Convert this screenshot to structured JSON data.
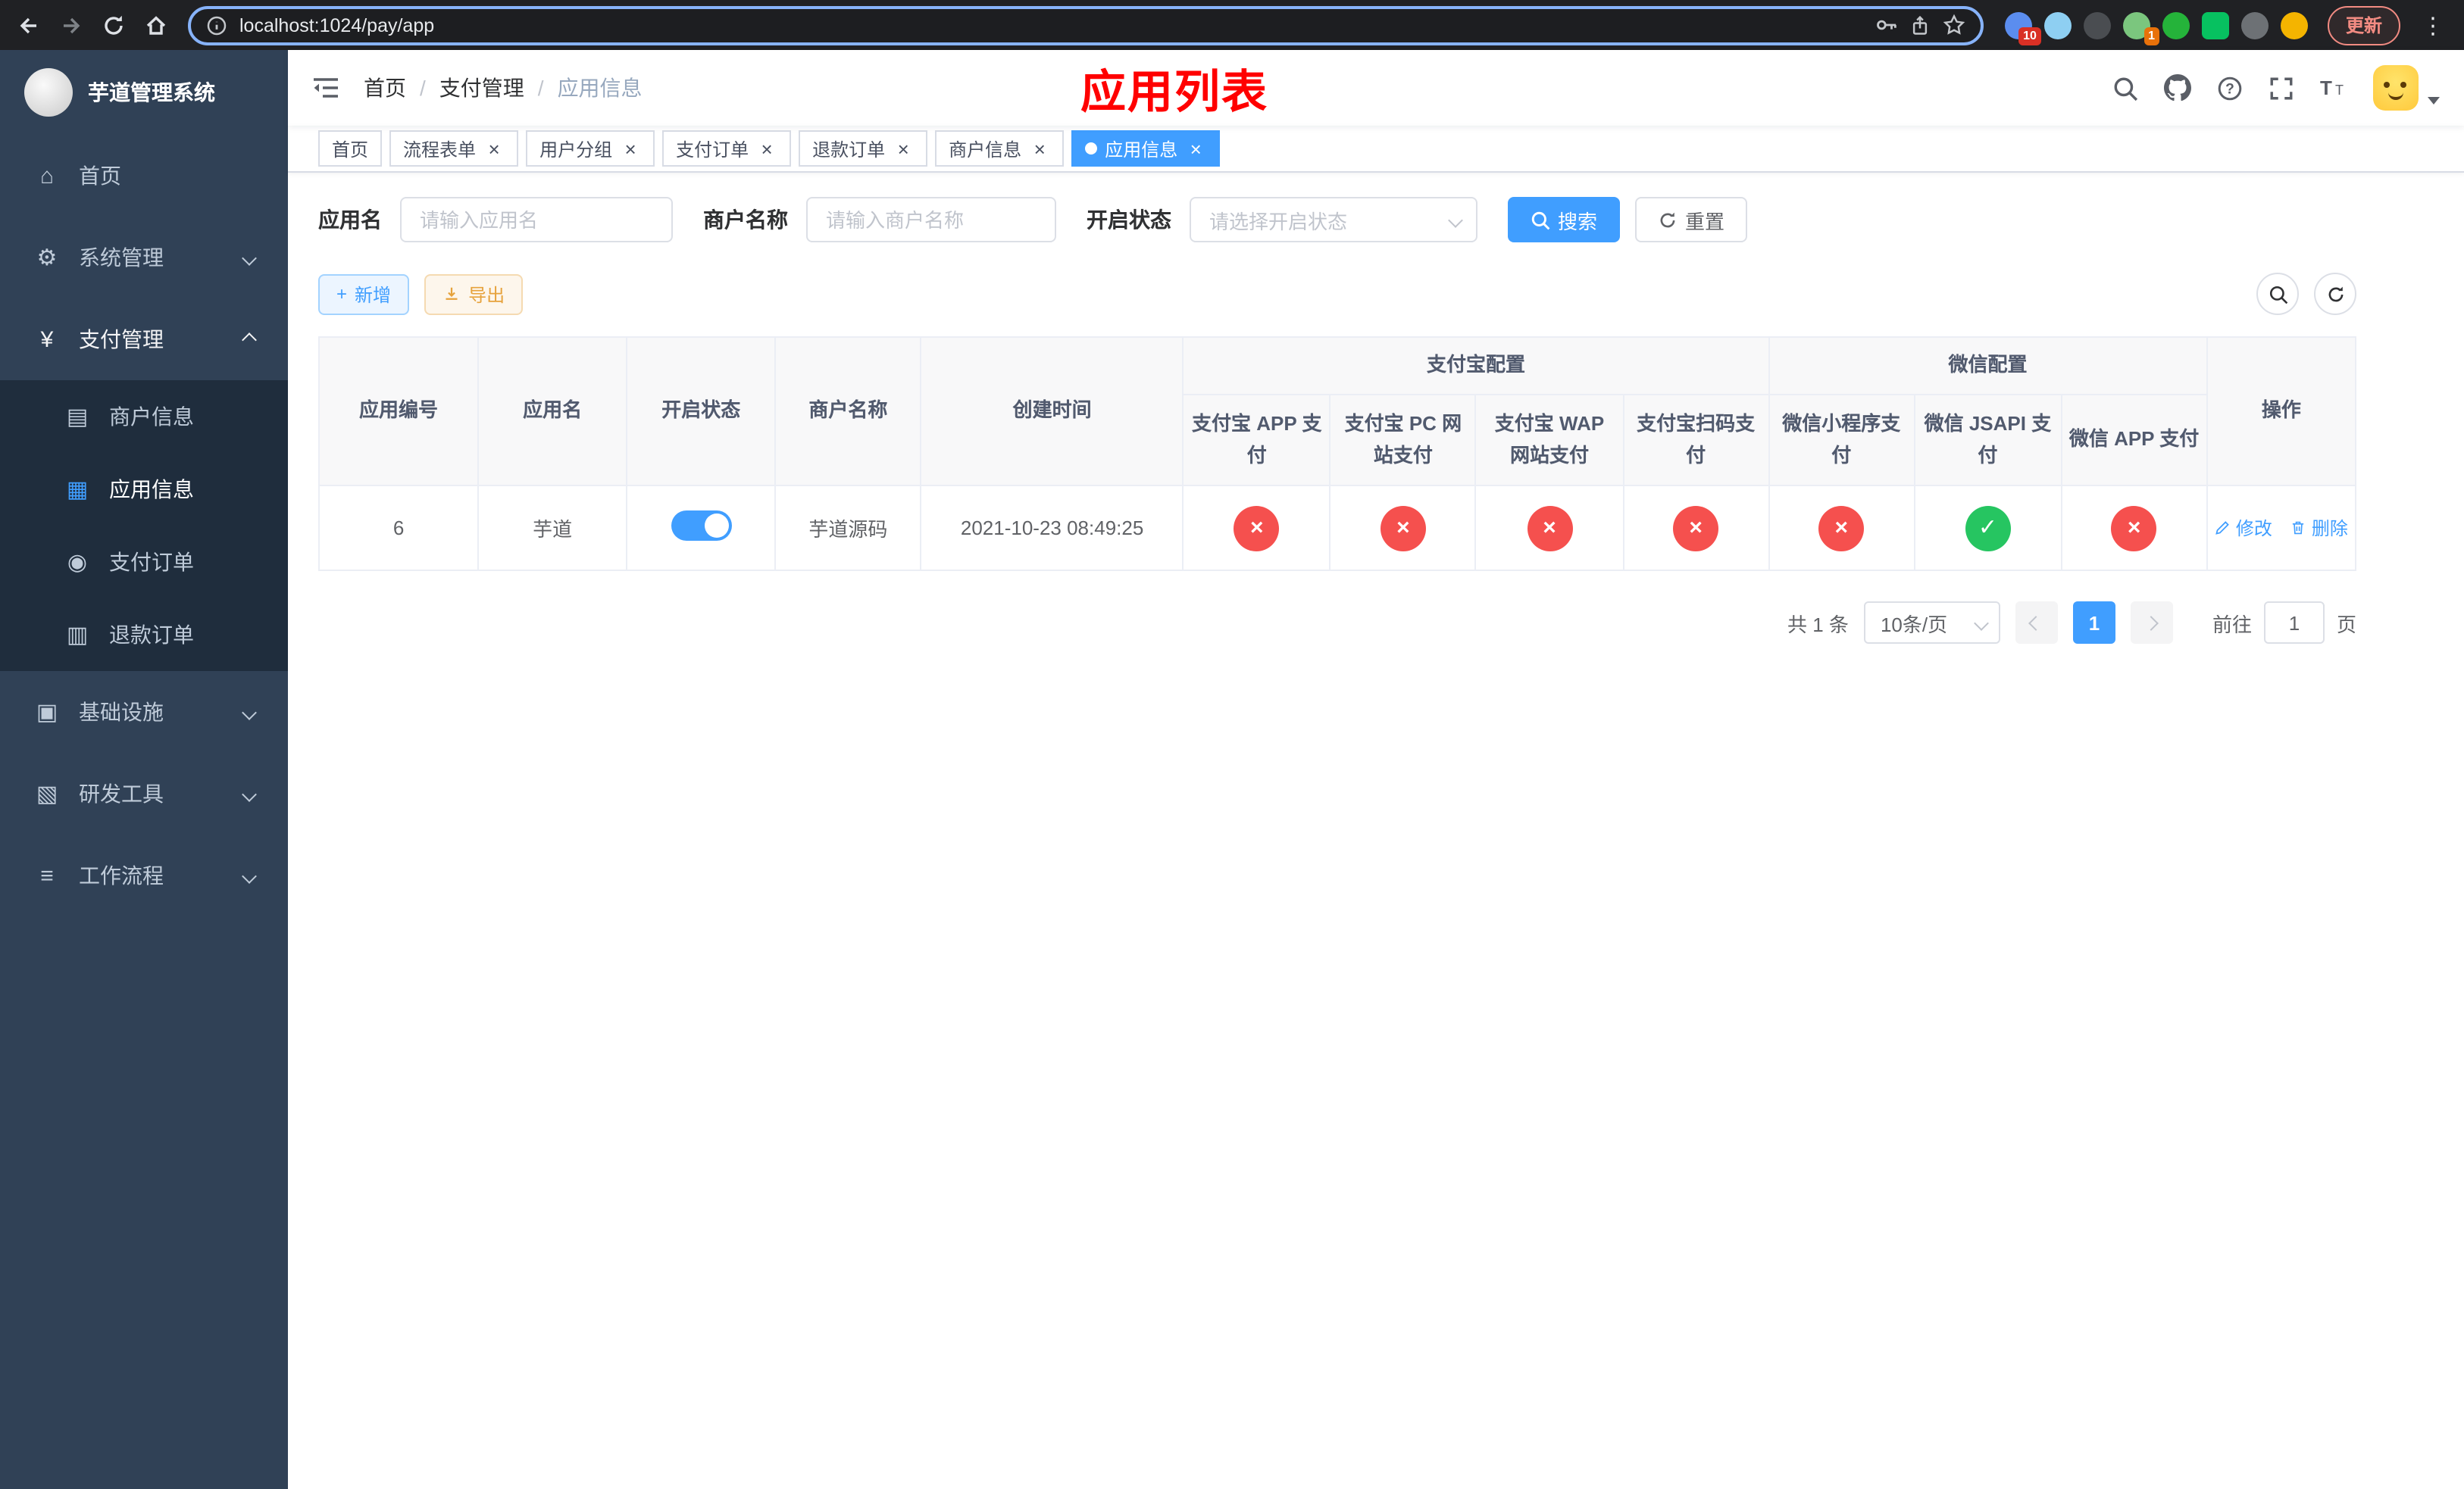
{
  "browser": {
    "url": "localhost:1024/pay/app",
    "update_label": "更新",
    "extension_badge_1": "10",
    "extension_badge_2": "1"
  },
  "sidebar": {
    "title": "芋道管理系统",
    "items": [
      {
        "label": "首页",
        "glyph": "⌂",
        "icon": "dashboard-icon"
      },
      {
        "label": "系统管理",
        "glyph": "⚙",
        "icon": "gear-icon"
      },
      {
        "label": "支付管理",
        "glyph": "¥",
        "icon": "yen-icon"
      },
      {
        "label": "商户信息",
        "glyph": "▤",
        "icon": "merchant-card-icon"
      },
      {
        "label": "应用信息",
        "glyph": "▦",
        "icon": "app-grid-icon"
      },
      {
        "label": "支付订单",
        "glyph": "◉",
        "icon": "pay-order-icon"
      },
      {
        "label": "退款订单",
        "glyph": "▥",
        "icon": "refund-order-icon"
      },
      {
        "label": "基础设施",
        "glyph": "▣",
        "icon": "infrastructure-icon"
      },
      {
        "label": "研发工具",
        "glyph": "▧",
        "icon": "dev-tools-icon"
      },
      {
        "label": "工作流程",
        "glyph": "≡",
        "icon": "workflow-icon"
      }
    ]
  },
  "header": {
    "breadcrumb": [
      "首页",
      "支付管理",
      "应用信息"
    ],
    "separator": "/",
    "page_title": "应用列表",
    "icons": [
      "search-icon",
      "github-icon",
      "help-icon",
      "fullscreen-icon",
      "font-size-icon",
      "avatar"
    ]
  },
  "tabs": [
    {
      "label": "首页"
    },
    {
      "label": "流程表单"
    },
    {
      "label": "用户分组"
    },
    {
      "label": "支付订单"
    },
    {
      "label": "退款订单"
    },
    {
      "label": "商户信息"
    },
    {
      "label": "应用信息"
    }
  ],
  "filters": {
    "app_name_label": "应用名",
    "app_name_placeholder": "请输入应用名",
    "merchant_label": "商户名称",
    "merchant_placeholder": "请输入商户名称",
    "status_label": "开启状态",
    "status_placeholder": "请选择开启状态",
    "search_label": "搜索",
    "reset_label": "重置"
  },
  "toolbar": {
    "plus": "+",
    "add_label": "新增",
    "export_label": "导出"
  },
  "table": {
    "group_alipay": "支付宝配置",
    "group_wechat": "微信配置",
    "columns": {
      "id": "应用编号",
      "name": "应用名",
      "status": "开启状态",
      "merchant": "商户名称",
      "created": "创建时间",
      "alipay_app": "支付宝 APP 支付",
      "alipay_pc": "支付宝 PC 网站支付",
      "alipay_wap": "支付宝 WAP 网站支付",
      "alipay_qr": "支付宝扫码支付",
      "wx_mini": "微信小程序支付",
      "wx_jsapi": "微信 JSAPI 支付",
      "wx_app": "微信 APP 支付",
      "actions": "操作"
    },
    "rows": [
      {
        "id": "6",
        "name": "芋道",
        "status_on": true,
        "merchant": "芋道源码",
        "created": "2021-10-23 08:49:25",
        "alipay_app": "no",
        "alipay_pc": "no",
        "alipay_wap": "no",
        "alipay_qr": "no",
        "wx_mini": "no",
        "wx_jsapi": "yes",
        "wx_app": "no",
        "edit_label": "修改",
        "delete_label": "删除"
      }
    ]
  },
  "pagination": {
    "total_text": "共 1 条",
    "page_size": "10条/页",
    "current_page": "1",
    "goto_label": "前往",
    "goto_value": "1",
    "page_unit": "页"
  },
  "icons": {
    "check": "✓",
    "cross": "×",
    "close": "×"
  },
  "colors": {
    "accent": "#409eff",
    "danger": "#f5504e",
    "success": "#26c561",
    "sidebar_bg": "#304156",
    "submenu_bg": "#1f2d3d",
    "title_red": "#ff0000",
    "header_bg": "#f8f8f9"
  }
}
